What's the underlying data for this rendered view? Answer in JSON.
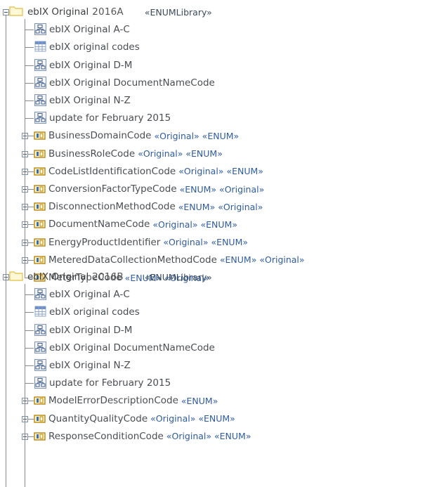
{
  "tree": {
    "libraries": [
      {
        "name": "ebIX Original",
        "version": "2016A",
        "stereotype": "«ENUMLibrary»",
        "diagrams": [
          {
            "label": "ebIX Original A-C",
            "icon": "diagram-icon"
          },
          {
            "label": "ebIX original codes",
            "icon": "table-icon"
          },
          {
            "label": "ebIX Original D-M",
            "icon": "diagram-icon"
          },
          {
            "label": "ebIX Original DocumentNameCode",
            "icon": "diagram-icon"
          },
          {
            "label": "ebIX Original N-Z",
            "icon": "diagram-icon"
          },
          {
            "label": "update for February 2015",
            "icon": "diagram-icon"
          }
        ],
        "enums": [
          {
            "name": "BusinessDomainCode",
            "stereotypes": "«Original» «ENUM»",
            "expandable": true
          },
          {
            "name": "BusinessRoleCode",
            "stereotypes": "«Original» «ENUM»",
            "expandable": true
          },
          {
            "name": "CodeListIdentificationCode",
            "stereotypes": "«Original» «ENUM»",
            "expandable": true
          },
          {
            "name": "ConversionFactorTypeCode",
            "stereotypes": "«ENUM» «Original»",
            "expandable": true
          },
          {
            "name": "DisconnectionMethodCode",
            "stereotypes": "«ENUM» «Original»",
            "expandable": true
          },
          {
            "name": "DocumentNameCode",
            "stereotypes": "«Original» «ENUM»",
            "expandable": true
          },
          {
            "name": "EnergyProductIdentifier",
            "stereotypes": "«Original» «ENUM»",
            "expandable": true
          },
          {
            "name": "MeteredDataCollectionMethodCode",
            "stereotypes": "«ENUM» «Original»",
            "expandable": true
          },
          {
            "name": "MeterTypeCode",
            "stereotypes": "«ENUM» «Original»",
            "expandable": false
          }
        ]
      },
      {
        "name": "ebIX Original",
        "version": "2016B",
        "stereotype": "«ENUMLibrary»",
        "diagrams": [
          {
            "label": "ebIX Original A-C",
            "icon": "diagram-icon"
          },
          {
            "label": "ebIX original codes",
            "icon": "table-icon"
          },
          {
            "label": "ebIX Original D-M",
            "icon": "diagram-icon"
          },
          {
            "label": "ebIX Original DocumentNameCode",
            "icon": "diagram-icon"
          },
          {
            "label": "ebIX Original N-Z",
            "icon": "diagram-icon"
          },
          {
            "label": "update for February 2015",
            "icon": "diagram-icon"
          }
        ],
        "enums": [
          {
            "name": "ModelErrorDescriptionCode",
            "stereotypes": "«ENUM»",
            "expandable": true
          },
          {
            "name": "QuantityQualityCode",
            "stereotypes": "«Original» «ENUM»",
            "expandable": true
          },
          {
            "name": "ResponseConditionCode",
            "stereotypes": "«Original» «ENUM»",
            "expandable": true
          }
        ]
      }
    ]
  },
  "colors": {
    "text": "#4a4e52",
    "stereotype": "#2f5c9e",
    "enum_icon": "#b8860b",
    "folder_icon": "#e6c85a",
    "tree_line": "#8a8a8a"
  }
}
